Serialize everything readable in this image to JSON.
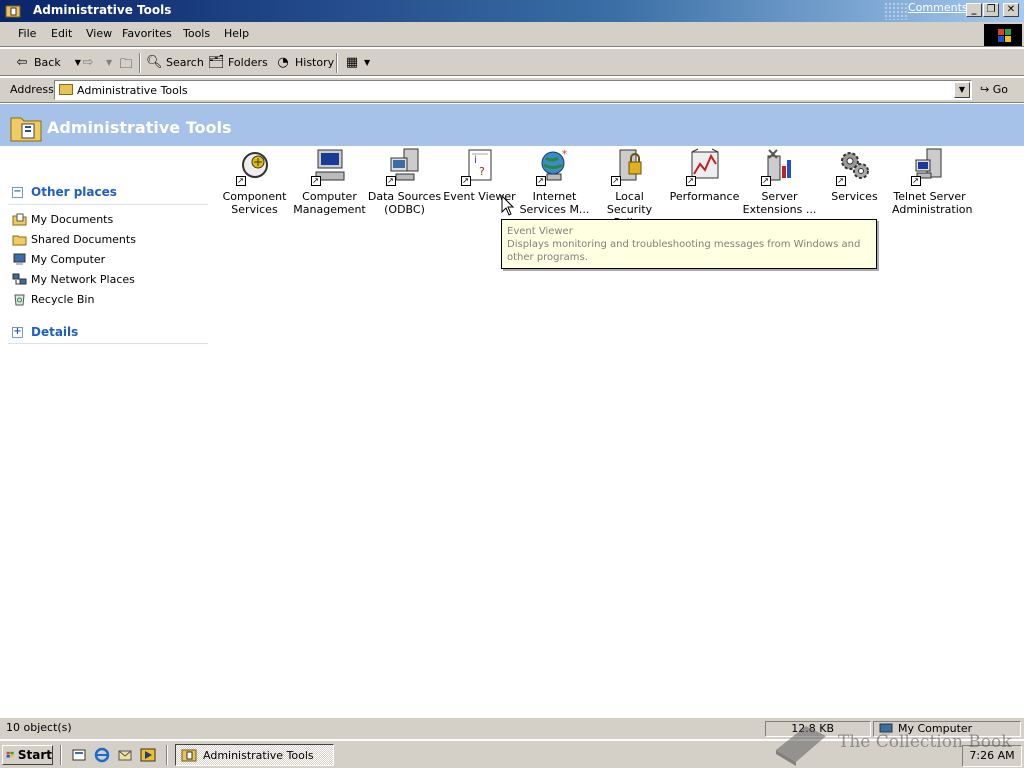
{
  "window": {
    "title": "Administrative Tools",
    "comments_link": "Comments?",
    "minimize": "_",
    "restore": "❐",
    "close": "✕"
  },
  "menu": [
    "File",
    "Edit",
    "View",
    "Favorites",
    "Tools",
    "Help"
  ],
  "toolbar": {
    "back": "Back",
    "search": "Search",
    "folders": "Folders",
    "history": "History"
  },
  "address": {
    "label": "Address",
    "value": "Administrative Tools",
    "go": "Go"
  },
  "header": {
    "title": "Administrative Tools"
  },
  "left_pane": {
    "other_places": {
      "heading": "Other places",
      "items": [
        {
          "label": "My Documents",
          "icon": "my-documents-icon"
        },
        {
          "label": "Shared Documents",
          "icon": "folder-icon"
        },
        {
          "label": "My Computer",
          "icon": "my-computer-icon"
        },
        {
          "label": "My Network Places",
          "icon": "network-places-icon"
        },
        {
          "label": "Recycle Bin",
          "icon": "recycle-bin-icon"
        }
      ]
    },
    "details": {
      "heading": "Details"
    }
  },
  "items": [
    {
      "line1": "Component",
      "line2": "Services",
      "icon": "component-services-icon"
    },
    {
      "line1": "Computer",
      "line2": "Management",
      "icon": "computer-management-icon"
    },
    {
      "line1": "Data Sources",
      "line2": "(ODBC)",
      "icon": "data-sources-icon"
    },
    {
      "line1": "Event Viewer",
      "line2": "",
      "icon": "event-viewer-icon"
    },
    {
      "line1": "Internet",
      "line2": "Services M...",
      "icon": "internet-services-icon"
    },
    {
      "line1": "Local Security",
      "line2": "Policy",
      "icon": "local-security-icon"
    },
    {
      "line1": "Performance",
      "line2": "",
      "icon": "performance-icon"
    },
    {
      "line1": "Server",
      "line2": "Extensions ...",
      "icon": "server-extensions-icon"
    },
    {
      "line1": "Services",
      "line2": "",
      "icon": "services-icon"
    },
    {
      "line1": "Telnet Server",
      "line2": "Administration",
      "icon": "telnet-server-icon"
    }
  ],
  "tooltip": {
    "title": "Event Viewer",
    "body": "Displays monitoring and troubleshooting messages from Windows and other programs."
  },
  "status": {
    "objects": "10 object(s)",
    "size": "12.8 KB",
    "zone": "My Computer"
  },
  "taskbar": {
    "start": "Start",
    "task": "Administrative Tools",
    "clock": "7:26 AM"
  },
  "watermark": {
    "text": "The Collection Book"
  }
}
